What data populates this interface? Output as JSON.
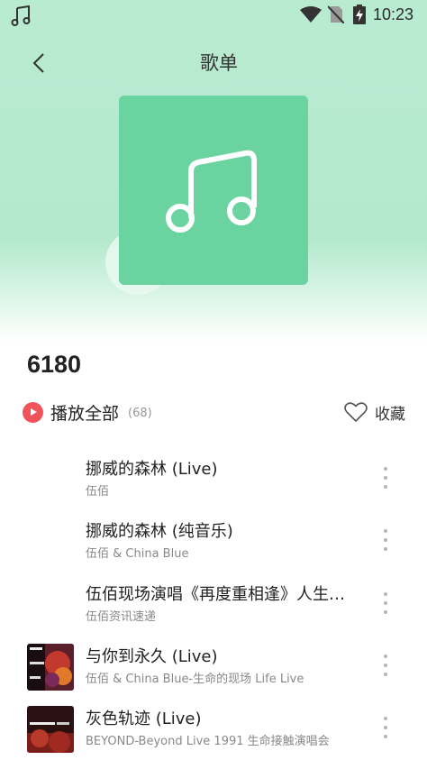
{
  "status_bar": {
    "time": "10:23",
    "icons": [
      "music-note-icon",
      "wifi-icon",
      "no-sim-icon",
      "battery-charging-icon"
    ]
  },
  "header": {
    "title": "歌单",
    "back_icon": "chevron-left-icon"
  },
  "playlist": {
    "name": "6180",
    "cover_icon": "music-note-icon",
    "cover_color": "#6bd39f"
  },
  "actions": {
    "play_all_label": "播放全部",
    "play_all_count": "(68)",
    "play_icon_color": "#f0545a",
    "favorite_label": "收藏"
  },
  "songs": [
    {
      "title": "挪威的森林 (Live)",
      "subtitle": "伍佰",
      "has_thumb": false
    },
    {
      "title": "挪威的森林 (纯音乐)",
      "subtitle": "伍佰 & China Blue",
      "has_thumb": false
    },
    {
      "title": "伍佰现场演唱《再度重相逢》人生大汽…",
      "subtitle": "伍佰资讯速递",
      "has_thumb": false
    },
    {
      "title": "与你到永久 (Live)",
      "subtitle": "伍佰 & China Blue-生命的现场 Life Live",
      "has_thumb": true
    },
    {
      "title": "灰色轨迹 (Live)",
      "subtitle": "BEYOND-Beyond Live 1991 生命接触演唱会",
      "has_thumb": true
    }
  ]
}
